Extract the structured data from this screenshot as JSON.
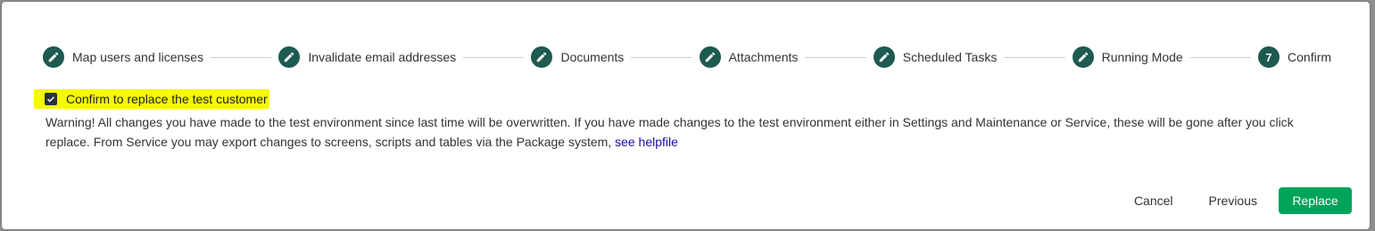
{
  "stepper": {
    "steps": [
      {
        "label": "Map users and licenses",
        "icon": "pencil-icon"
      },
      {
        "label": "Invalidate email addresses",
        "icon": "pencil-icon"
      },
      {
        "label": "Documents",
        "icon": "pencil-icon"
      },
      {
        "label": "Attachments",
        "icon": "pencil-icon"
      },
      {
        "label": "Scheduled Tasks",
        "icon": "pencil-icon"
      },
      {
        "label": "Running Mode",
        "icon": "pencil-icon"
      },
      {
        "label": "Confirm",
        "number": "7"
      }
    ]
  },
  "confirm": {
    "checked": true,
    "label": "Confirm to replace the test customer"
  },
  "warning": {
    "text": "Warning! All changes you have made to the test environment since last time will be overwritten. If you have made changes to the test environment either in Settings and Maintenance or Service, these will be gone after you click replace. From Service you may export changes to screens, scripts and tables via the Package system,",
    "link_text": "see helpfile"
  },
  "actions": {
    "cancel_label": "Cancel",
    "previous_label": "Previous",
    "replace_label": "Replace"
  },
  "colors": {
    "step_circle": "#1d5a4f",
    "primary_button": "#00a35a",
    "highlight": "#f5fa00",
    "link": "#1a0dab"
  }
}
